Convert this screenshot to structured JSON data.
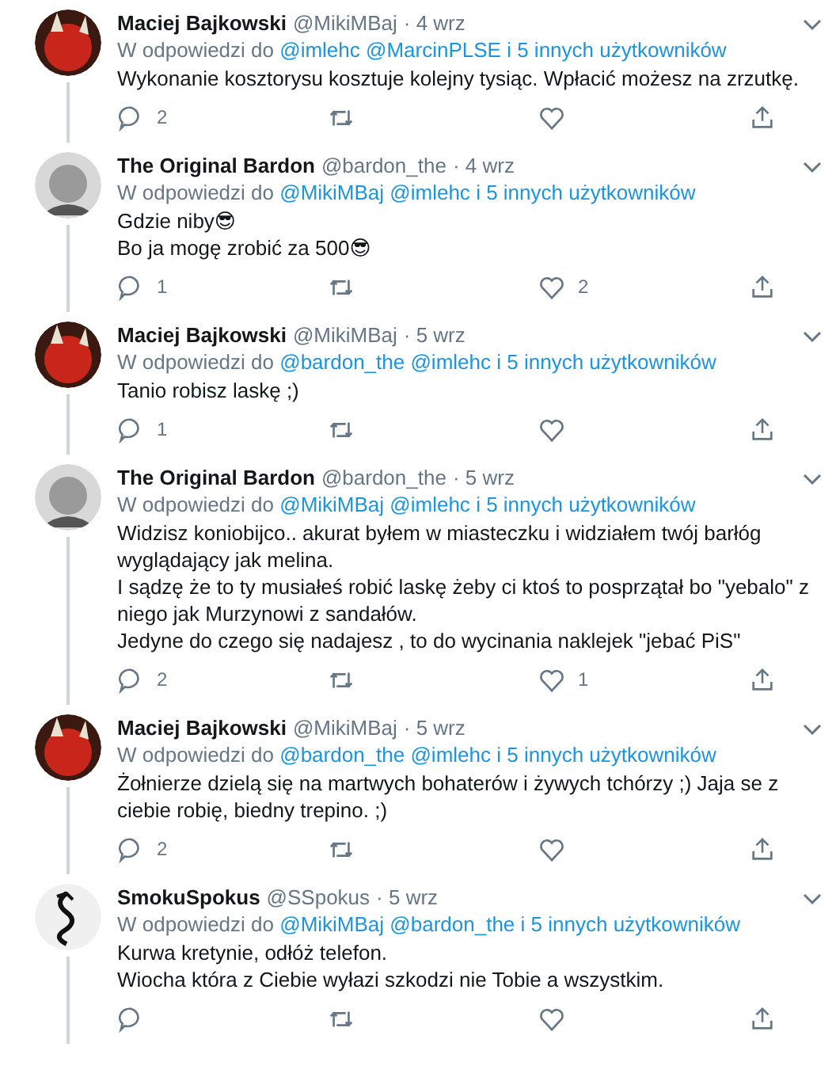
{
  "tweets": [
    {
      "avatar": {
        "kind": "devil"
      },
      "name": "Maciej Bajkowski",
      "handle": "@MikiMBaj",
      "date": "· 4 wrz",
      "reply_prefix": "W odpowiedzi do",
      "mentions": [
        "@imlehc",
        "@MarcinPLSE"
      ],
      "others": "i 5 innych użytkowników",
      "lines": [
        "Wykonanie kosztorysu kosztuje kolejny tysiąc. Wpłacić możesz na zrzutkę."
      ],
      "replies": "2"
    },
    {
      "avatar": {
        "kind": "portrait"
      },
      "name": "The Original Bardon",
      "handle": "@bardon_the",
      "date": "· 4 wrz",
      "reply_prefix": "W odpowiedzi do",
      "mentions": [
        "@MikiMBaj",
        "@imlehc"
      ],
      "others": "i 5 innych użytkowników",
      "lines": [
        "Gdzie niby😎",
        "Bo ja mogę zrobić za 500😎"
      ],
      "replies": "1",
      "likes": "2"
    },
    {
      "avatar": {
        "kind": "devil"
      },
      "name": "Maciej Bajkowski",
      "handle": "@MikiMBaj",
      "date": "· 5 wrz",
      "reply_prefix": "W odpowiedzi do",
      "mentions": [
        "@bardon_the",
        "@imlehc"
      ],
      "others": "i 5 innych użytkowników",
      "lines": [
        "Tanio robisz laskę ;)"
      ],
      "replies": "1"
    },
    {
      "avatar": {
        "kind": "portrait"
      },
      "name": "The Original Bardon",
      "handle": "@bardon_the",
      "date": "· 5 wrz",
      "reply_prefix": "W odpowiedzi do",
      "mentions": [
        "@MikiMBaj",
        "@imlehc"
      ],
      "others": "i 5 innych użytkowników",
      "lines": [
        "Widzisz koniobijco.. akurat byłem w miasteczku i widziałem twój barłóg wyglądający jak melina.",
        "I sądzę że to ty musiałeś robić laskę żeby ci ktoś to posprzątał bo \"yebalo\" z niego jak Murzynowi z sandałów.",
        "Jedyne do czego się nadajesz , to do wycinania naklejek \"jebać PiS\""
      ],
      "replies": "2",
      "likes": "1"
    },
    {
      "avatar": {
        "kind": "devil"
      },
      "name": "Maciej Bajkowski",
      "handle": "@MikiMBaj",
      "date": "· 5 wrz",
      "reply_prefix": "W odpowiedzi do",
      "mentions": [
        "@bardon_the",
        "@imlehc"
      ],
      "others": "i 5 innych użytkowników",
      "lines": [
        "Żołnierze dzielą się na martwych bohaterów i żywych tchórzy ;) Jaja se z ciebie robię, biedny trepino. ;)"
      ],
      "replies": "2"
    },
    {
      "avatar": {
        "kind": "dragon"
      },
      "name": "SmokuSpokus",
      "handle": "@SSpokus",
      "date": "· 5 wrz",
      "reply_prefix": "W odpowiedzi do",
      "mentions": [
        "@MikiMBaj",
        "@bardon_the"
      ],
      "others": "i 5 innych użytkowników",
      "lines": [
        "Kurwa kretynie, odłóż telefon.",
        "Wiocha która z Ciebie wyłazi szkodzi nie Tobie a wszystkim."
      ]
    }
  ]
}
